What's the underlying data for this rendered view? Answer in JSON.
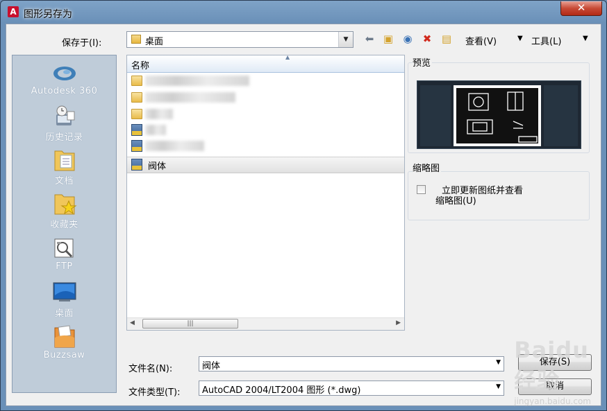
{
  "window": {
    "title": "图形另存为",
    "close_glyph": "✕"
  },
  "toolbar": {
    "save_in_label": "保存于(I):",
    "location": "桌面",
    "view_label": "查看(V)",
    "tools_label": "工具(L)"
  },
  "places": [
    {
      "label": "Autodesk 360",
      "icon": "cloud-icon"
    },
    {
      "label": "历史记录",
      "icon": "history-icon"
    },
    {
      "label": "文档",
      "icon": "documents-folder-icon"
    },
    {
      "label": "收藏夹",
      "icon": "favorites-folder-icon"
    },
    {
      "label": "FTP",
      "icon": "ftp-icon"
    },
    {
      "label": "桌面",
      "icon": "desktop-icon"
    },
    {
      "label": "Buzzsaw",
      "icon": "buzzsaw-icon"
    }
  ],
  "file_list": {
    "column_header": "名称",
    "selected_file": "阀体"
  },
  "preview": {
    "title": "预览"
  },
  "thumbnail": {
    "title": "缩略图",
    "checkbox_label_line1": "立即更新图纸并查看",
    "checkbox_label_line2": "缩略图(U)",
    "checked": false
  },
  "form": {
    "filename_label": "文件名(N):",
    "filename_value": "阀体",
    "filetype_label": "文件类型(T):",
    "filetype_value": "AutoCAD 2004/LT2004 图形 (*.dwg)",
    "save_button": "保存(S)",
    "cancel_button": "取消"
  },
  "watermark": {
    "logo": "Baidu经验",
    "url": "jingyan.baidu.com"
  },
  "colors": {
    "accent": "#6a90b8",
    "places_bg": "#bfccd9",
    "close_red": "#c74a36"
  }
}
